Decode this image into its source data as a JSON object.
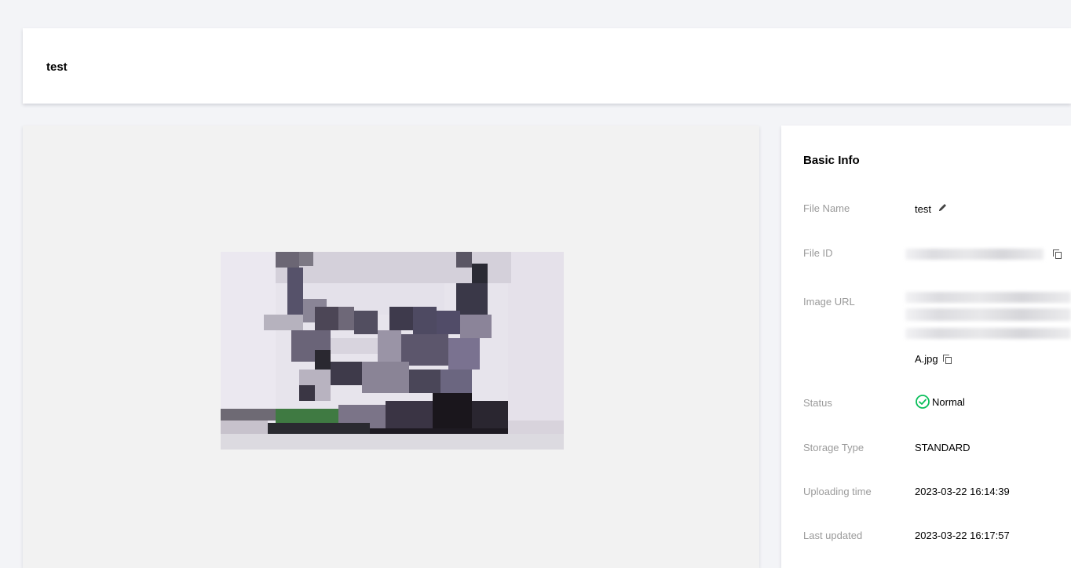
{
  "header": {
    "title": "test"
  },
  "preview": {
    "alt": "image preview"
  },
  "basic_info": {
    "title": "Basic Info",
    "file_name": {
      "label": "File Name",
      "value": "test"
    },
    "file_id": {
      "label": "File ID"
    },
    "image_url": {
      "label": "Image URL",
      "suffix": "A.jpg"
    },
    "status": {
      "label": "Status",
      "value": "Normal",
      "color": "#0abf5b"
    },
    "storage_type": {
      "label": "Storage Type",
      "value": "STANDARD"
    },
    "uploading_time": {
      "label": "Uploading time",
      "value": "2023-03-22 16:14:39"
    },
    "last_updated": {
      "label": "Last updated",
      "value": "2023-03-22 16:17:57"
    }
  },
  "icons": [
    "edit-icon",
    "copy-icon",
    "check-circle-icon"
  ]
}
